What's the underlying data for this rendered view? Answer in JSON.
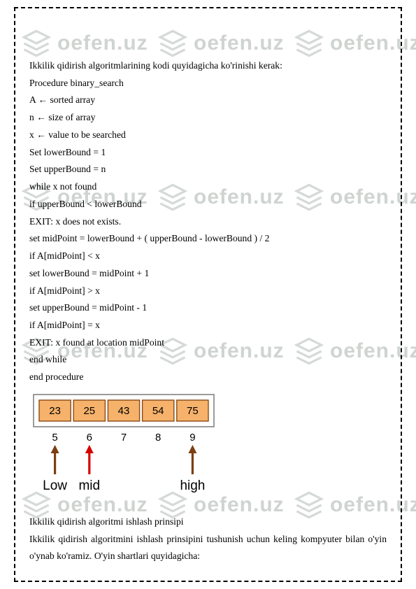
{
  "watermark": "oefen.uz",
  "lines": {
    "l1": "Ikkilik qidirish algoritmlarining kodi quyidagicha ko'rinishi kerak:",
    "l2": "Procedure binary_search",
    "l3": "A ← sorted array",
    "l4": "n ← size of array",
    "l5": "x ← value to be searched",
    "l6": "Set lowerBound = 1",
    "l7": "Set upperBound = n",
    "l8": "while x not found",
    "l9": "if upperBound < lowerBound",
    "l10": "EXIT: x does not exists.",
    "l11": "set midPoint = lowerBound + ( upperBound - lowerBound ) / 2",
    "l12": "if A[midPoint] < x",
    "l13": "set lowerBound = midPoint + 1",
    "l14": "if A[midPoint] > x",
    "l15": "set upperBound = midPoint - 1",
    "l16": "if A[midPoint] = x",
    "l17": "EXIT: x found at location midPoint",
    "l18": "end while",
    "l19": "end procedure"
  },
  "diagram": {
    "cells": [
      "23",
      "25",
      "43",
      "54",
      "75"
    ],
    "indices": [
      "5",
      "6",
      "7",
      "8",
      "9"
    ],
    "labels": {
      "low": "Low",
      "mid": "mid",
      "high": "high"
    },
    "colors": {
      "cell_fill": "#f6b26b",
      "cell_border": "#8a4a16",
      "outer_border": "#7a7a7a",
      "arrow_brown": "#7b3f12",
      "arrow_red": "#d40000",
      "text": "#000000"
    }
  },
  "para": {
    "p1": "Ikkilik qidirish algoritmi ishlash prinsipi",
    "p2": "Ikkilik qidirish algoritmini ishlash prinsipini tushunish uchun keling kompyuter bilan o'yin o'ynab ko'ramiz. O'yin shartlari quyidagicha:"
  }
}
